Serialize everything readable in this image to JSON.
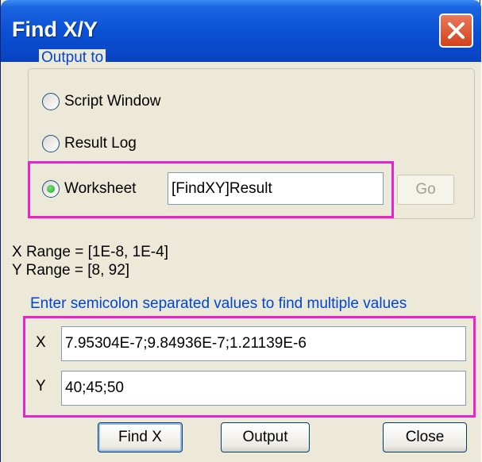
{
  "window": {
    "title": "Find X/Y"
  },
  "output_group": {
    "legend": "Output to",
    "options": [
      {
        "label": "Script Window",
        "selected": false
      },
      {
        "label": "Result Log",
        "selected": false
      },
      {
        "label": "Worksheet",
        "selected": true
      }
    ],
    "worksheet_value": "[FindXY]Result",
    "go_label": "Go"
  },
  "ranges": {
    "x_range": "X Range = [1E-8, 1E-4]",
    "y_range": "Y Range = [8, 92]"
  },
  "hint": "Enter semicolon separated values to find multiple values",
  "inputs": {
    "x_label": "X",
    "x_value": "7.95304E-7;9.84936E-7;1.21139E-6",
    "y_label": "Y",
    "y_value": "40;45;50"
  },
  "buttons": {
    "find": "Find X",
    "output": "Output",
    "close": "Close"
  },
  "colors": {
    "accent": "#0046d5",
    "highlight": "#ee22cc",
    "titlebar": "#0a4fd3"
  }
}
